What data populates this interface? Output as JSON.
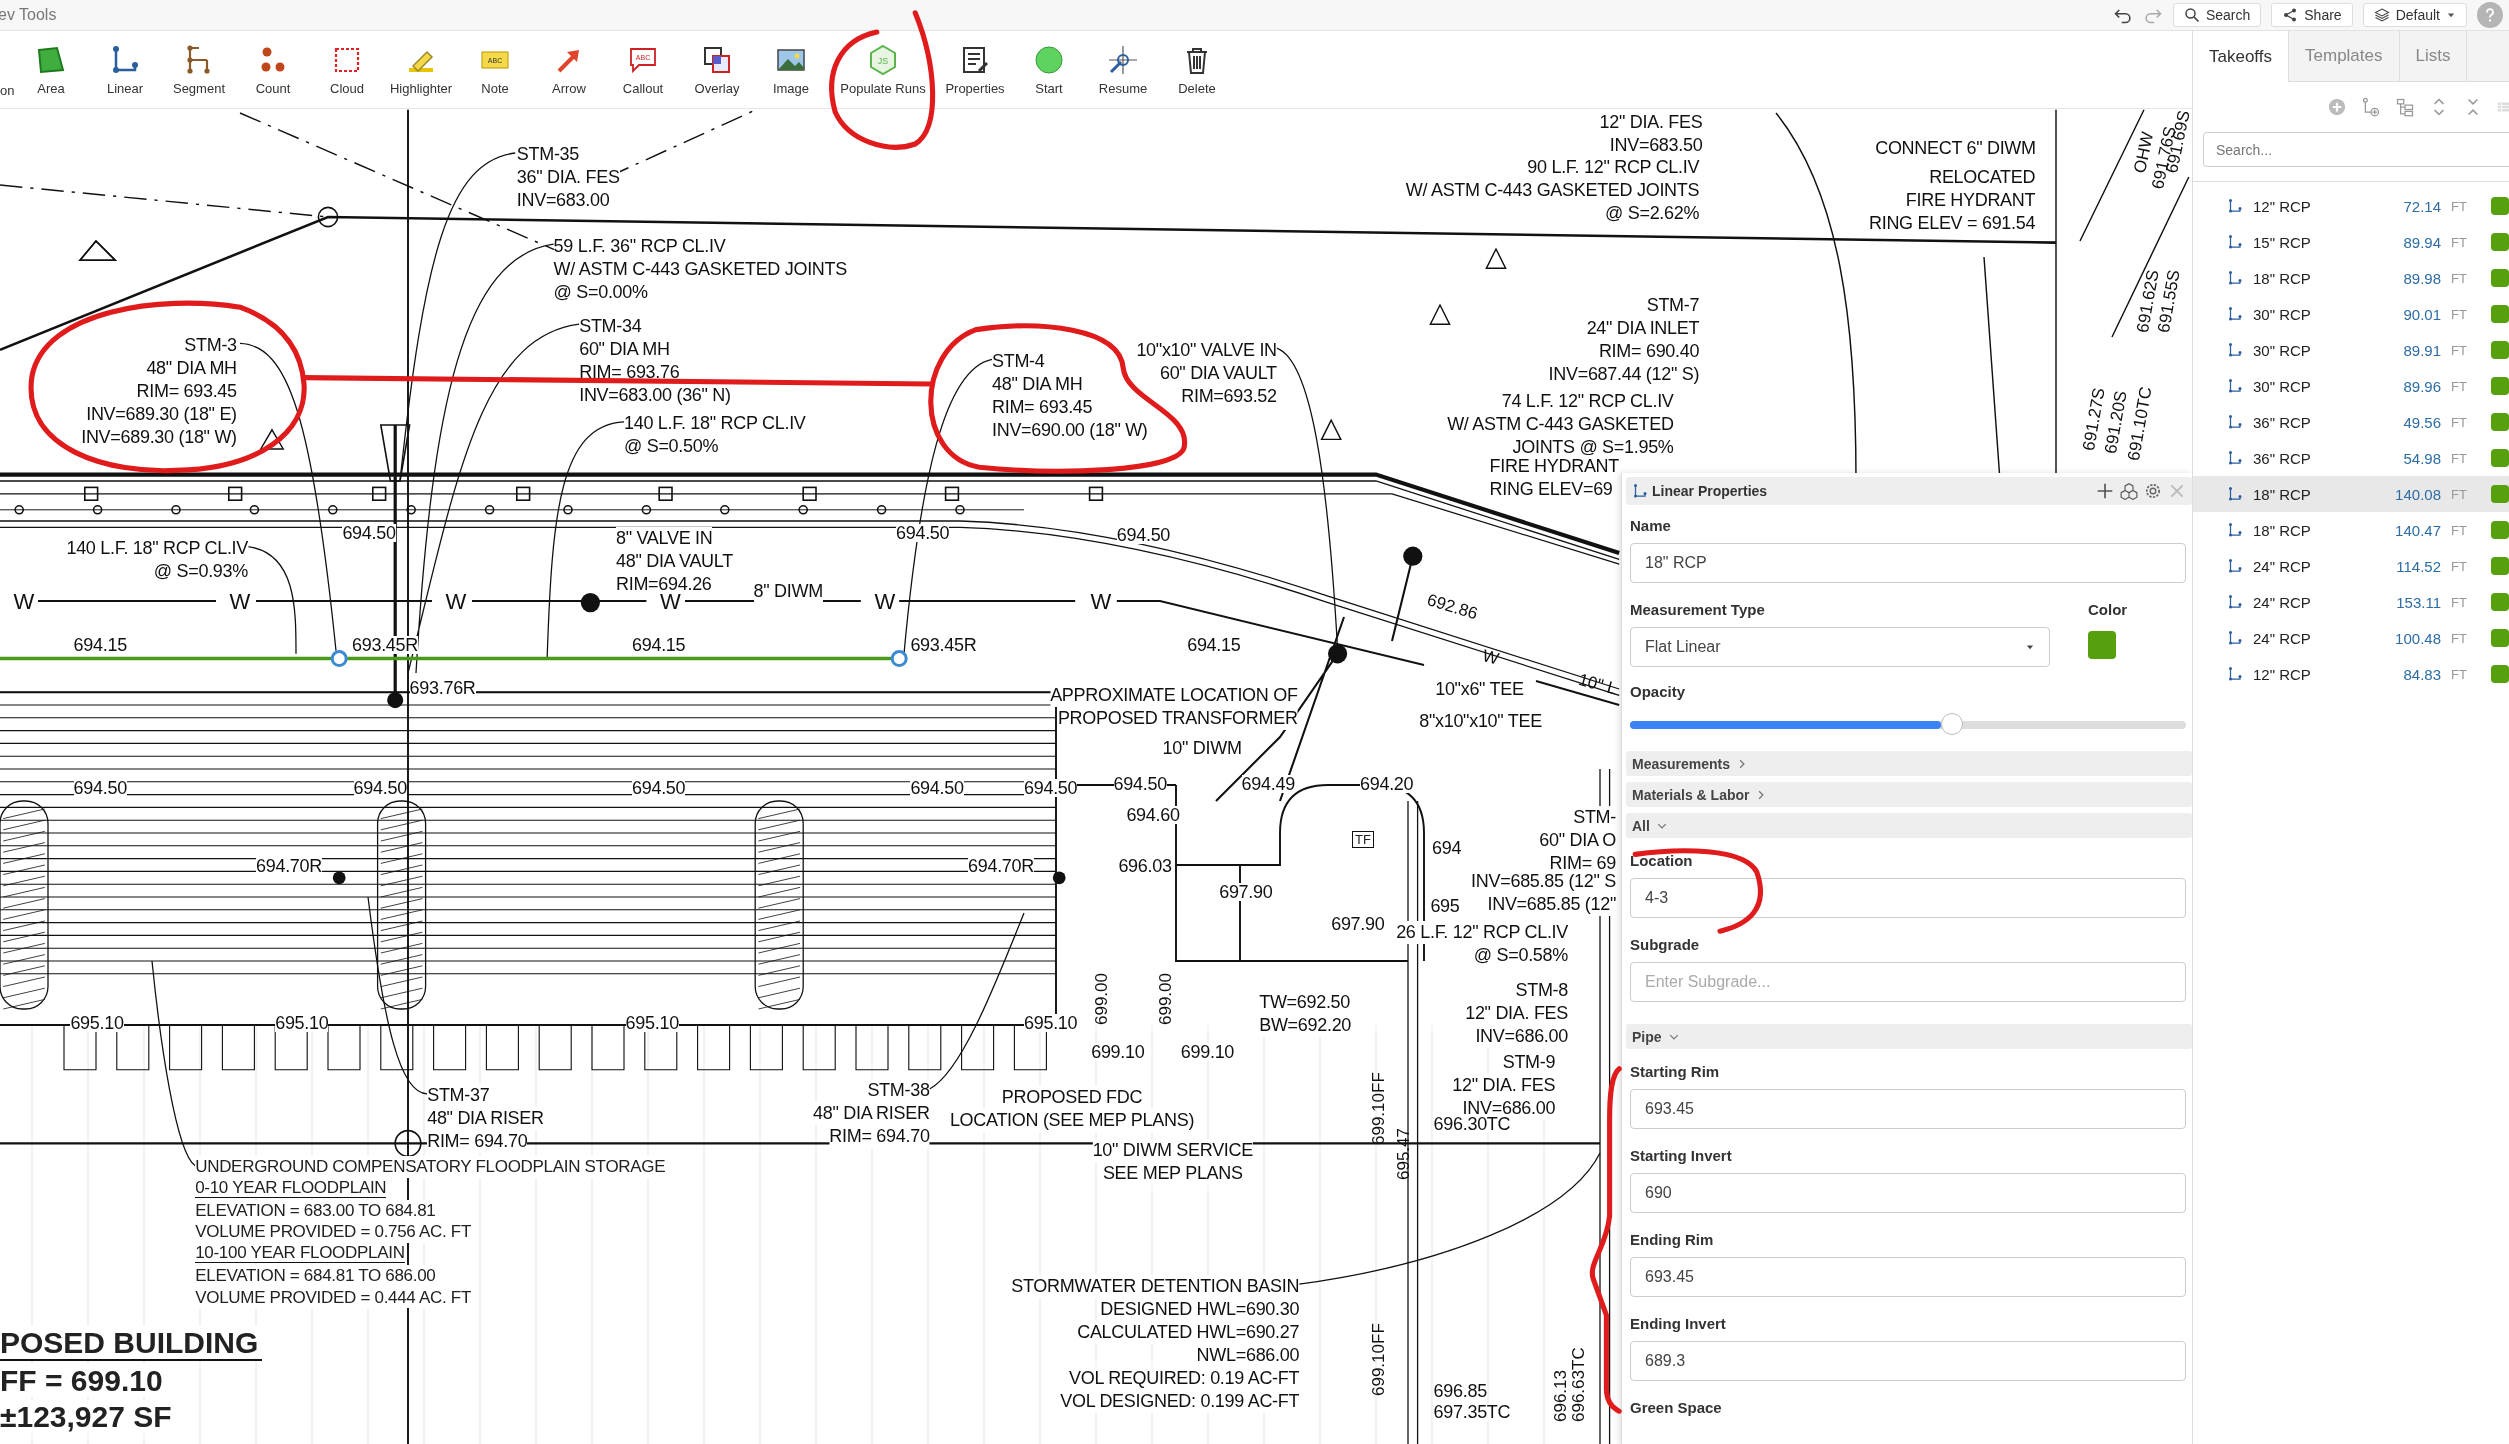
{
  "app_bar": {
    "title": "ev Tools",
    "search_label": "Search",
    "share_label": "Share",
    "view_label": "Default"
  },
  "toolbar": [
    {
      "label": "on"
    },
    {
      "label": "Area"
    },
    {
      "label": "Linear"
    },
    {
      "label": "Segment"
    },
    {
      "label": "Count"
    },
    {
      "label": "Cloud"
    },
    {
      "label": "Highlighter"
    },
    {
      "label": "Note",
      "icon_text": "ABC"
    },
    {
      "label": "Arrow"
    },
    {
      "label": "Callout",
      "icon_text": "ABC"
    },
    {
      "label": "Overlay"
    },
    {
      "label": "Image"
    },
    {
      "label": "Populate Runs",
      "icon_text": "JS"
    },
    {
      "label": "Properties"
    },
    {
      "label": "Start"
    },
    {
      "label": "Resume"
    },
    {
      "label": "Delete"
    }
  ],
  "drawing": {
    "notes": [
      {
        "lines": [
          "STM-35",
          "36\" DIA. FES",
          "INV=683.00"
        ]
      },
      {
        "lines": [
          "59 L.F. 36\" RCP CL.IV",
          "W/ ASTM C-443 GASKETED JOINTS",
          "@ S=0.00%"
        ]
      },
      {
        "lines": [
          "12\" DIA. FES",
          "INV=683.50"
        ]
      },
      {
        "lines": [
          "90 L.F. 12\" RCP CL.IV",
          "W/ ASTM C-443 GASKETED JOINTS",
          "@ S=2.62%"
        ]
      },
      {
        "lines": [
          "CONNECT 6\" DIWM"
        ]
      },
      {
        "lines": [
          "RELOCATED",
          "FIRE HYDRANT",
          "RING ELEV = 691.54"
        ]
      },
      {
        "lines": [
          "STM-3",
          "48\" DIA MH",
          "RIM= 693.45",
          "INV=689.30 (18\" E)",
          "INV=689.30 (18\" W)"
        ]
      },
      {
        "lines": [
          "STM-34",
          "60\" DIA MH",
          "RIM= 693.76",
          "INV=683.00 (36\" N)"
        ]
      },
      {
        "lines": [
          "STM-4",
          "48\" DIA MH",
          "RIM= 693.45",
          "INV=690.00 (18\" W)"
        ]
      },
      {
        "lines": [
          "10\"x10\" VALVE IN",
          "60\" DIA VAULT",
          "RIM=693.52"
        ]
      },
      {
        "lines": [
          "STM-7",
          "24\" DIA INLET",
          "RIM= 690.40",
          "INV=687.44 (12\" S)"
        ]
      },
      {
        "lines": [
          "74 L.F. 12\" RCP CL.IV",
          "W/ ASTM C-443 GASKETED",
          "JOINTS @ S=1.95%"
        ]
      },
      {
        "lines": [
          "FIRE HYDRANT",
          "RING ELEV=69"
        ]
      },
      {
        "lines": [
          "140 L.F. 18\" RCP CL.IV",
          "@ S=0.50%"
        ]
      },
      {
        "lines": [
          "140 L.F. 18\" RCP CL.IV",
          "@ S=0.93%"
        ]
      },
      {
        "lines": [
          "8\" VALVE IN",
          "48\" DIA VAULT",
          "RIM=694.26"
        ]
      },
      {
        "lines": [
          "8\" DIWM"
        ]
      },
      {
        "lines": [
          "APPROXIMATE LOCATION OF",
          "PROPOSED TRANSFORMER"
        ]
      },
      {
        "lines": [
          "10\"x6\" TEE"
        ]
      },
      {
        "lines": [
          "8\"x10\"x10\" TEE"
        ]
      },
      {
        "lines": [
          "10\" DIWM"
        ]
      },
      {
        "lines": [
          "STM-",
          "60\" DIA O",
          "RIM= 69"
        ]
      },
      {
        "lines": [
          "INV=685.85 (12\" S",
          "INV=685.85 (12\""
        ]
      },
      {
        "lines": [
          "26 L.F. 12\" RCP CL.IV",
          "@ S=0.58%"
        ]
      },
      {
        "lines": [
          "STM-8",
          "12\" DIA. FES",
          "INV=686.00"
        ]
      },
      {
        "lines": [
          "STM-9",
          "12\" DIA. FES",
          "INV=686.00"
        ]
      },
      {
        "lines": [
          "TW=692.50",
          "BW=692.20"
        ]
      },
      {
        "lines": [
          "STM-37",
          "48\" DIA RISER",
          "RIM= 694.70"
        ]
      },
      {
        "lines": [
          "STM-38",
          "48\" DIA RISER",
          "RIM= 694.70"
        ]
      },
      {
        "lines": [
          "PROPOSED FDC",
          "LOCATION (SEE MEP PLANS)"
        ]
      },
      {
        "lines": [
          "10\" DIWM SERVICE",
          "SEE MEP PLANS"
        ]
      },
      {
        "lines": [
          "STORMWATER DETENTION BASIN",
          "DESIGNED HWL=690.30",
          "CALCULATED HWL=690.27",
          "NWL=686.00",
          "VOL REQUIRED: 0.19 AC-FT",
          "VOL DESIGNED: 0.199 AC-FT"
        ]
      }
    ],
    "spot_elevations": [
      "694.50",
      "694.50",
      "694.50",
      "694.15",
      "693.45R",
      "694.15",
      "693.45R",
      "693.76R",
      "694.15",
      "694.50",
      "694.50",
      "694.50",
      "694.50",
      "694.50",
      "694.50",
      "694.49",
      "694.20",
      "694.60",
      "694",
      "694.70R",
      "694.70R",
      "696.03",
      "697.90",
      "695",
      "697.90",
      "695.10",
      "695.10",
      "695.10",
      "695.10",
      "699.10",
      "699.10",
      "696.30TC",
      "696.85",
      "697.35TC"
    ],
    "rotated_labels": [
      "692.86",
      "W",
      "10\" L",
      "699.00",
      "699.00",
      "699.10FF",
      "695.47",
      "699.10FF",
      "696.13",
      "696.63TC",
      "OHW",
      "691.76S",
      "691.69S",
      "691.62S",
      "691.55S",
      "691.27S",
      "691.20S",
      "691.10TC"
    ],
    "water_marks": [
      "W",
      "W",
      "W",
      "W",
      "W",
      "W"
    ],
    "equipment_tag": "TF",
    "floodplain_legend": [
      {
        "text": "UNDERGROUND COMPENSATORY FLOODPLAIN STORAGE",
        "underlined": false
      },
      {
        "text": "0-10 YEAR FLOODPLAIN",
        "underlined": true
      },
      {
        "text": "ELEVATION = 683.00 TO 684.81",
        "underlined": false
      },
      {
        "text": "VOLUME PROVIDED = 0.756 AC. FT",
        "underlined": false
      },
      {
        "text": "10-100 YEAR FLOODPLAIN",
        "underlined": true
      },
      {
        "text": "ELEVATION = 684.81 TO 686.00",
        "underlined": false
      },
      {
        "text": "VOLUME PROVIDED = 0.444 AC. FT",
        "underlined": false
      }
    ],
    "building_label": [
      "POSED BUILDING",
      "FF = 699.10",
      "±123,927 SF"
    ]
  },
  "properties_panel": {
    "title": "Linear Properties",
    "name_label": "Name",
    "name_value": "18\" RCP",
    "measurement_type_label": "Measurement Type",
    "measurement_type": "Flat Linear",
    "color_label": "Color",
    "color": "#55a00c",
    "opacity_label": "Opacity",
    "opacity": {
      "level": 0.58
    },
    "sections": [
      {
        "title": "Measurements",
        "expanded": false
      },
      {
        "title": "Materials & Labor",
        "expanded": false
      },
      {
        "title": "All",
        "expanded": true,
        "fields": [
          {
            "label": "Location",
            "value": "4-3"
          },
          {
            "label": "Subgrade",
            "placeholder": "Enter Subgrade..."
          }
        ]
      },
      {
        "title": "Pipe",
        "expanded": true,
        "fields": [
          {
            "label": "Starting Rim",
            "value": "693.45"
          },
          {
            "label": "Starting Invert",
            "value": "690"
          },
          {
            "label": "Ending Rim",
            "value": "693.45"
          },
          {
            "label": "Ending Invert",
            "value": "689.3"
          },
          {
            "label": "Green Space"
          }
        ]
      }
    ]
  },
  "right_panel": {
    "tabs": [
      {
        "label": "Takeoffs",
        "selected": true
      },
      {
        "label": "Templates",
        "selected": false
      },
      {
        "label": "Lists",
        "selected": false
      }
    ],
    "search_placeholder": "Search...",
    "takeoffs": [
      {
        "name": "12\" RCP",
        "value": "72.14",
        "unit": "FT",
        "color": "#55a00c",
        "selected": false
      },
      {
        "name": "15\" RCP",
        "value": "89.94",
        "unit": "FT",
        "color": "#55a00c",
        "selected": false
      },
      {
        "name": "18\" RCP",
        "value": "89.98",
        "unit": "FT",
        "color": "#55a00c",
        "selected": false
      },
      {
        "name": "30\" RCP",
        "value": "90.01",
        "unit": "FT",
        "color": "#55a00c",
        "selected": false
      },
      {
        "name": "30\" RCP",
        "value": "89.91",
        "unit": "FT",
        "color": "#55a00c",
        "selected": false
      },
      {
        "name": "30\" RCP",
        "value": "89.96",
        "unit": "FT",
        "color": "#55a00c",
        "selected": false
      },
      {
        "name": "36\" RCP",
        "value": "49.56",
        "unit": "FT",
        "color": "#55a00c",
        "selected": false
      },
      {
        "name": "36\" RCP",
        "value": "54.98",
        "unit": "FT",
        "color": "#55a00c",
        "selected": false
      },
      {
        "name": "18\" RCP",
        "value": "140.08",
        "unit": "FT",
        "color": "#55a00c",
        "selected": true
      },
      {
        "name": "18\" RCP",
        "value": "140.47",
        "unit": "FT",
        "color": "#55a00c",
        "selected": false
      },
      {
        "name": "24\" RCP",
        "value": "114.52",
        "unit": "FT",
        "color": "#55a00c",
        "selected": false
      },
      {
        "name": "24\" RCP",
        "value": "153.11",
        "unit": "FT",
        "color": "#55a00c",
        "selected": false
      },
      {
        "name": "24\" RCP",
        "value": "100.48",
        "unit": "FT",
        "color": "#55a00c",
        "selected": false
      },
      {
        "name": "12\" RCP",
        "value": "84.83",
        "unit": "FT",
        "color": "#55a00c",
        "selected": false
      }
    ]
  }
}
